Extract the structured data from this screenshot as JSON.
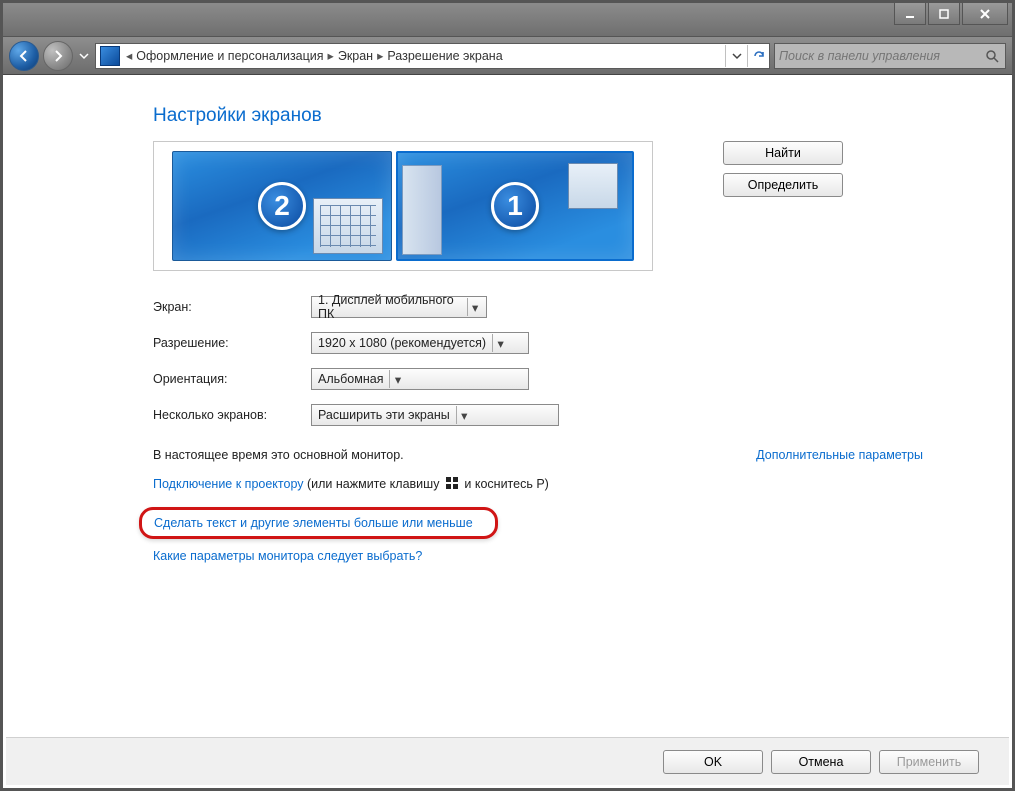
{
  "breadcrumb": {
    "item1": "Оформление и персонализация",
    "item2": "Экран",
    "item3": "Разрешение экрана"
  },
  "search": {
    "placeholder": "Поиск в панели управления"
  },
  "page": {
    "title": "Настройки экранов"
  },
  "preview": {
    "monitor1_badge": "1",
    "monitor2_badge": "2",
    "find_btn": "Найти",
    "identify_btn": "Определить"
  },
  "settings": {
    "screen_label": "Экран:",
    "screen_value": "1. Дисплей мобильного ПК",
    "res_label": "Разрешение:",
    "res_value": "1920 x 1080 (рекомендуется)",
    "orient_label": "Ориентация:",
    "orient_value": "Альбомная",
    "mult_label": "Несколько экранов:",
    "mult_value": "Расширить эти экраны"
  },
  "info": {
    "main_monitor": "В настоящее время это основной монитор.",
    "adv_link": "Дополнительные параметры"
  },
  "projector": {
    "link": "Подключение к проектору",
    "paren_open": " (или нажмите клавишу ",
    "paren_close": " и коснитесь P)"
  },
  "text_size_link": "Сделать текст и другие элементы больше или меньше",
  "which_monitor_link": "Какие параметры монитора следует выбрать?",
  "footer": {
    "ok": "OK",
    "cancel": "Отмена",
    "apply": "Применить"
  }
}
